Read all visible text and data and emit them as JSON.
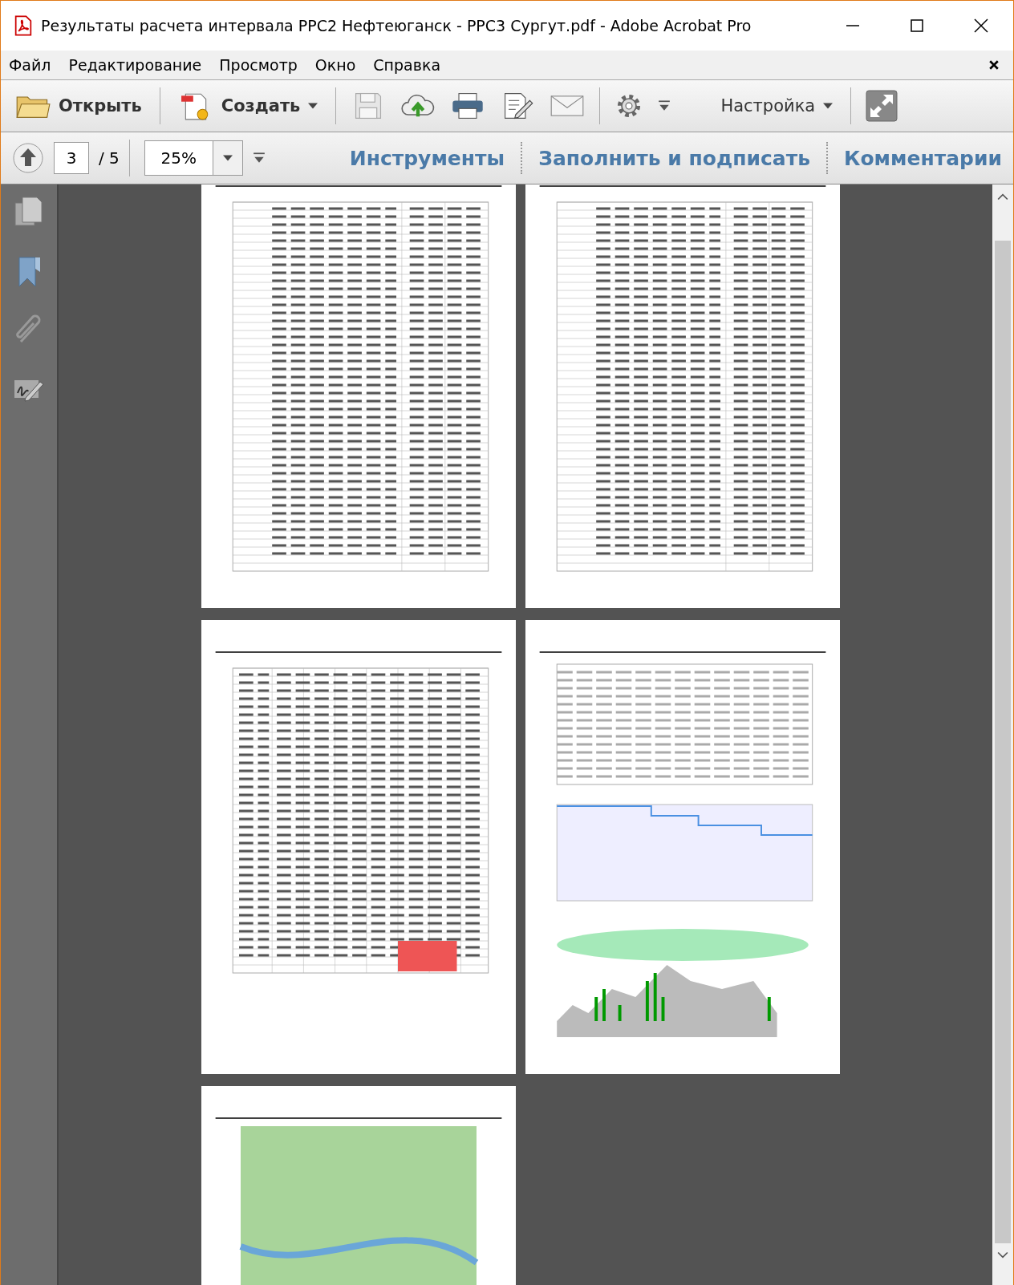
{
  "window": {
    "title": "Результаты расчета интервала РРС2 Нефтеюганск - РРС3 Сургут.pdf - Adobe Acrobat Pro"
  },
  "menu": [
    "Файл",
    "Редактирование",
    "Просмотр",
    "Окно",
    "Справка"
  ],
  "toolbar": {
    "open": "Открыть",
    "create": "Создать",
    "customize": "Настройка"
  },
  "nav": {
    "page": "3",
    "total": "/ 5",
    "zoom": "25%"
  },
  "panes": [
    {
      "label": "Инструменты"
    },
    {
      "label": "Заполнить и подписать"
    },
    {
      "label": "Комментарии"
    }
  ],
  "pages": [
    {
      "kind": "table"
    },
    {
      "kind": "table"
    },
    {
      "kind": "table"
    },
    {
      "kind": "chart"
    },
    {
      "kind": "map"
    }
  ]
}
